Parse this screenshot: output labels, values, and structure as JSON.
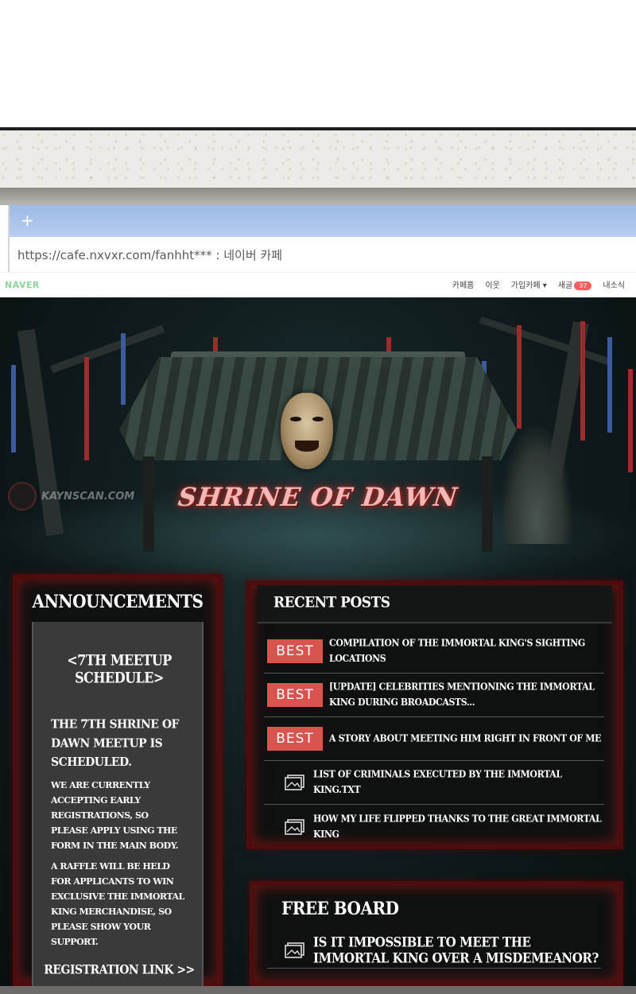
{
  "browser": {
    "new_tab_label": "+",
    "url": "https://cafe.nxvxr.com/fanhht*** : 네이버 카페"
  },
  "naver_bar": {
    "logo": "NAVER",
    "menu": [
      "카페홈",
      "이웃",
      "가입카페 ▾",
      "새글",
      "내소식"
    ],
    "new_posts_count": "37"
  },
  "header": {
    "title": "SHRINE OF DAWN",
    "watermark": "KAYNSCAN.COM"
  },
  "announcements": {
    "title": "ANNOUNCEMENTS",
    "schedule": "<7TH MEETUP SCHEDULE>",
    "p1": "THE 7TH SHRINE OF DAWN MEETUP IS SCHEDULED.",
    "p2": "WE ARE CURRENTLY ACCEPTING EARLY REGISTRATIONS, SO PLEASE APPLY USING THE FORM IN THE MAIN BODY.",
    "p3": "A RAFFLE WILL BE HELD FOR APPLICANTS TO WIN EXCLUSIVE THE IMMORTAL KING MERCHANDISE, SO PLEASE SHOW YOUR SUPPORT.",
    "link": "REGISTRATION LINK >>"
  },
  "recent_posts": {
    "title": "RECENT POSTS",
    "best_label": "BEST",
    "posts": [
      {
        "text": "COMPILATION OF THE IMMORTAL KING'S SIGHTING LOCATIONS"
      },
      {
        "text": "[UPDATE] CELEBRITIES MENTIONING THE IMMORTAL KING DURING BROADCASTS..."
      },
      {
        "text": "A STORY ABOUT MEETING HIM RIGHT IN FRONT OF ME"
      },
      {
        "text": "LIST OF CRIMINALS EXECUTED BY THE IMMORTAL KING.TXT"
      },
      {
        "text": "HOW MY LIFE FLIPPED THANKS TO THE GREAT IMMORTAL KING"
      }
    ]
  },
  "free_board": {
    "title": "FREE BOARD",
    "posts": [
      {
        "text": "IS IT IMPOSSIBLE TO MEET THE IMMORTAL KING OVER A MISDEMEANOR?"
      }
    ]
  },
  "colors": {
    "best_badge": "#d9534f",
    "title_glow": "#c0392b",
    "frame_blood": "#4d0d0d",
    "tab_bar": "#9cbbe6"
  }
}
